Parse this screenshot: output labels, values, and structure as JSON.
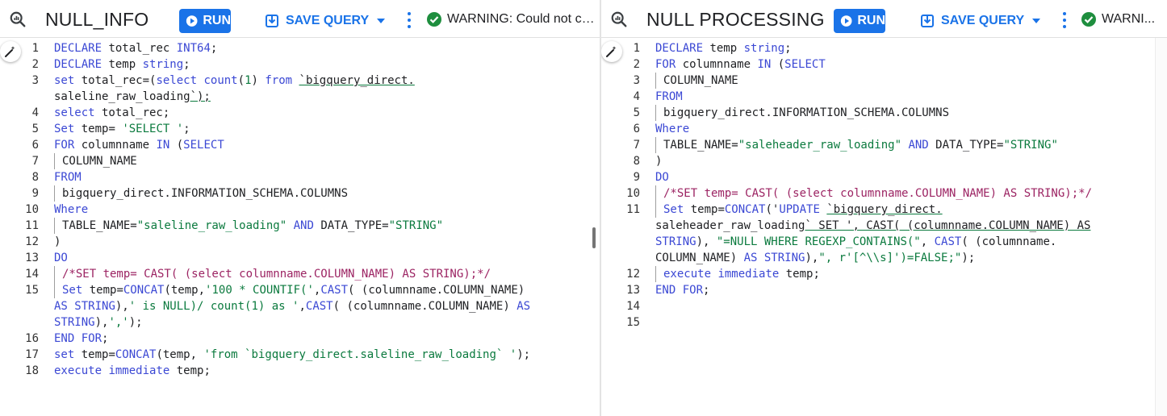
{
  "left": {
    "title": "NULL_INFO",
    "run_label": "RUN",
    "save_label": "SAVE QUERY",
    "status_text": "WARNING: Could not co...",
    "line_numbers": [
      "1",
      "2",
      "3",
      "4",
      "5",
      "6",
      "7",
      "8",
      "9",
      "10",
      "11",
      "12",
      "13",
      "14",
      "15",
      "16",
      "17",
      "18"
    ],
    "code": [
      "DECLARE total_rec INT64;",
      "DECLARE temp string;",
      "set total_rec=(select count(1) from `bigquery_direct.",
      "saleline_raw_loading`);",
      "select total_rec;",
      "Set temp= 'SELECT ';",
      "FOR columnname IN (SELECT",
      "COLUMN_NAME",
      "FROM",
      "bigquery_direct.INFORMATION_SCHEMA.COLUMNS",
      "Where",
      "TABLE_NAME=\"saleline_raw_loading\" AND DATA_TYPE=\"STRING\"",
      ")",
      "DO",
      "/*SET temp= CAST( (select columnname.COLUMN_NAME) AS STRING);*/",
      "Set temp=CONCAT(temp,'100 * COUNTIF(',CAST( (columnname.COLUMN_NAME)",
      "AS STRING),' is NULL)/ count(1) as ',CAST( (columnname.COLUMN_NAME) AS",
      "STRING),',');",
      "END FOR;",
      "set temp=CONCAT(temp, 'from `bigquery_direct.saleline_raw_loading` ');",
      "execute immediate temp;"
    ]
  },
  "right": {
    "title": "NULL PROCESSING",
    "run_label": "RUN",
    "save_label": "SAVE QUERY",
    "status_text": "WARNI...",
    "line_numbers": [
      "1",
      "2",
      "3",
      "4",
      "5",
      "6",
      "7",
      "8",
      "9",
      "10",
      "11",
      "12",
      "13",
      "14",
      "15"
    ],
    "code": [
      "DECLARE temp string;",
      "FOR columnname IN (SELECT",
      "COLUMN_NAME",
      "FROM",
      "bigquery_direct.INFORMATION_SCHEMA.COLUMNS",
      "Where",
      "TABLE_NAME=\"saleheader_raw_loading\" AND DATA_TYPE=\"STRING\"",
      ")",
      "DO",
      "/*SET temp= CAST( (select columnname.COLUMN_NAME) AS STRING);*/",
      "Set temp=CONCAT('UPDATE `bigquery_direct.",
      "saleheader_raw_loading` SET ', CAST( (columnname.COLUMN_NAME) AS",
      "STRING), \"=NULL WHERE REGEXP_CONTAINS(\", CAST( (columnname.",
      "COLUMN_NAME) AS STRING),\", r'[^\\\\s]')=FALSE;\");",
      "execute immediate temp;",
      "END FOR;"
    ]
  },
  "colors": {
    "accent": "#1a73e8",
    "keyword": "#3b48d4",
    "string": "#0b7a3e",
    "comment": "#9c2463",
    "status_ok": "#1e8e3e"
  },
  "icons": {
    "query": "query-icon",
    "run": "play-circle-icon",
    "save": "save-icon",
    "menu": "more-vert-icon",
    "status": "check-circle-icon",
    "format": "magic-wand-icon"
  }
}
